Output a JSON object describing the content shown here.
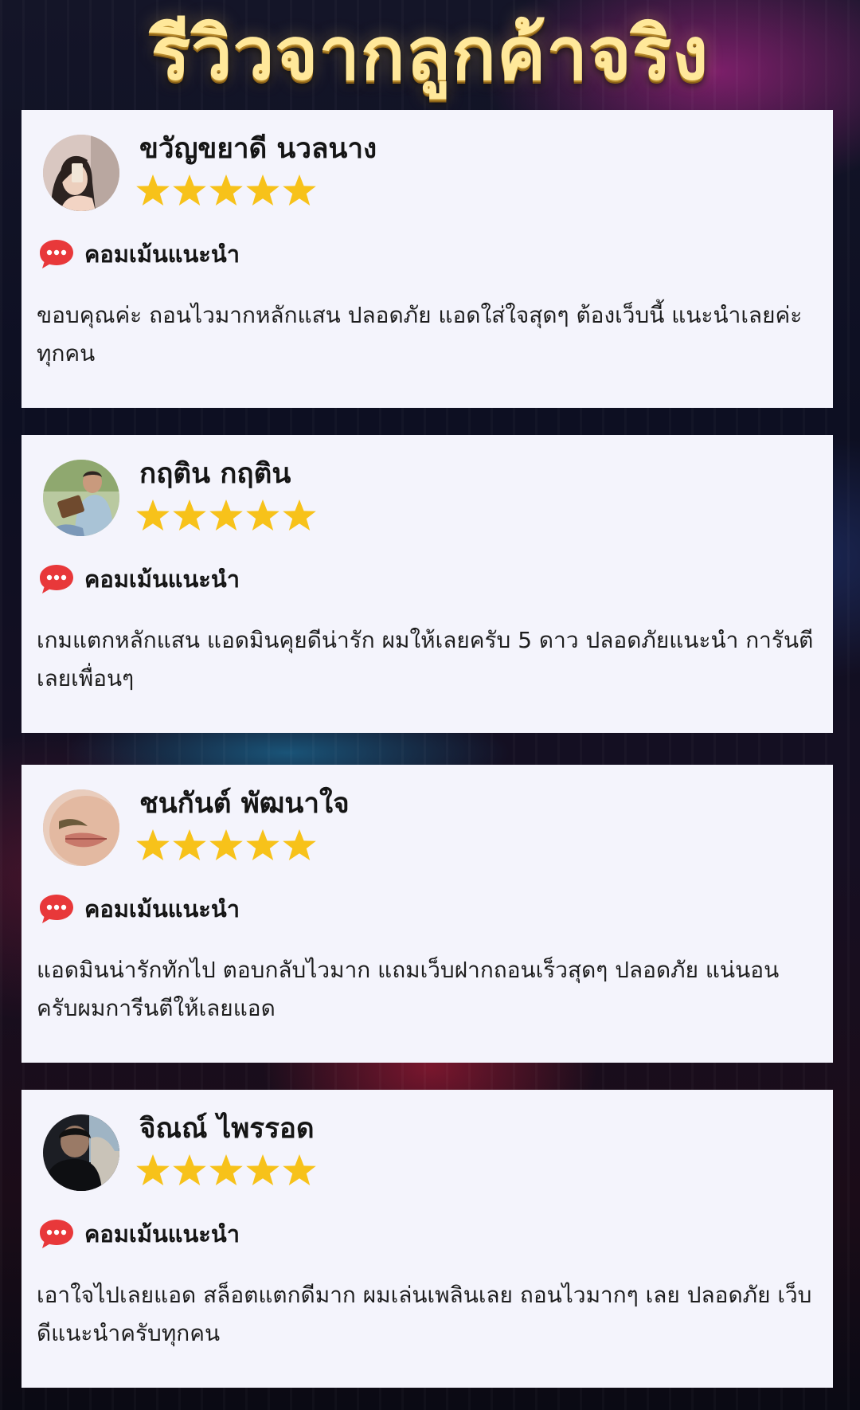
{
  "page": {
    "title": "รีวิวจากลูกค้าจริง"
  },
  "colors": {
    "title_gold": "#ffe89a",
    "card_bg": "#f4f4fc",
    "star_gold": "#f7c21a",
    "comment_red": "#e8383a"
  },
  "reviews": [
    {
      "name": "ขวัญขยาดี นวลนาง",
      "rating": 5,
      "comment_label": "คอมเม้นแนะนำ",
      "text": "ขอบคุณค่ะ ถอนไวมากหลักแสน ปลอดภัย แอดใส่ใจสุดๆ ต้องเว็บนี้ แนะนำเลยค่ะทุกคน",
      "avatar_icon": "user-avatar"
    },
    {
      "name": "กฤติน กฤติน",
      "rating": 5,
      "comment_label": "คอมเม้นแนะนำ",
      "text": "เกมแตกหลักแสน แอดมินคุยดีน่ารัก ผมให้เลยครับ 5 ดาว ปลอดภัยแนะนำ การันตีเลยเพื่อนๆ",
      "avatar_icon": "user-avatar"
    },
    {
      "name": "ชนกันต์ พัฒนาใจ",
      "rating": 5,
      "comment_label": "คอมเม้นแนะนำ",
      "text": "แอดมินน่ารักทักไป ตอบกลับไวมาก แถมเว็บฝากถอนเร็วสุดๆ ปลอดภัย แน่นอนครับผมการีนตีให้เลยแอด",
      "avatar_icon": "user-avatar"
    },
    {
      "name": "จิณณ์ ไพรรอด",
      "rating": 5,
      "comment_label": "คอมเม้นแนะนำ",
      "text": "เอาใจไปเลยแอด สล็อตแตกดีมาก ผมเล่นเพลินเลย ถอนไวมากๆ เลย ปลอดภัย เว็บดีแนะนำครับทุกคน",
      "avatar_icon": "user-avatar"
    }
  ]
}
